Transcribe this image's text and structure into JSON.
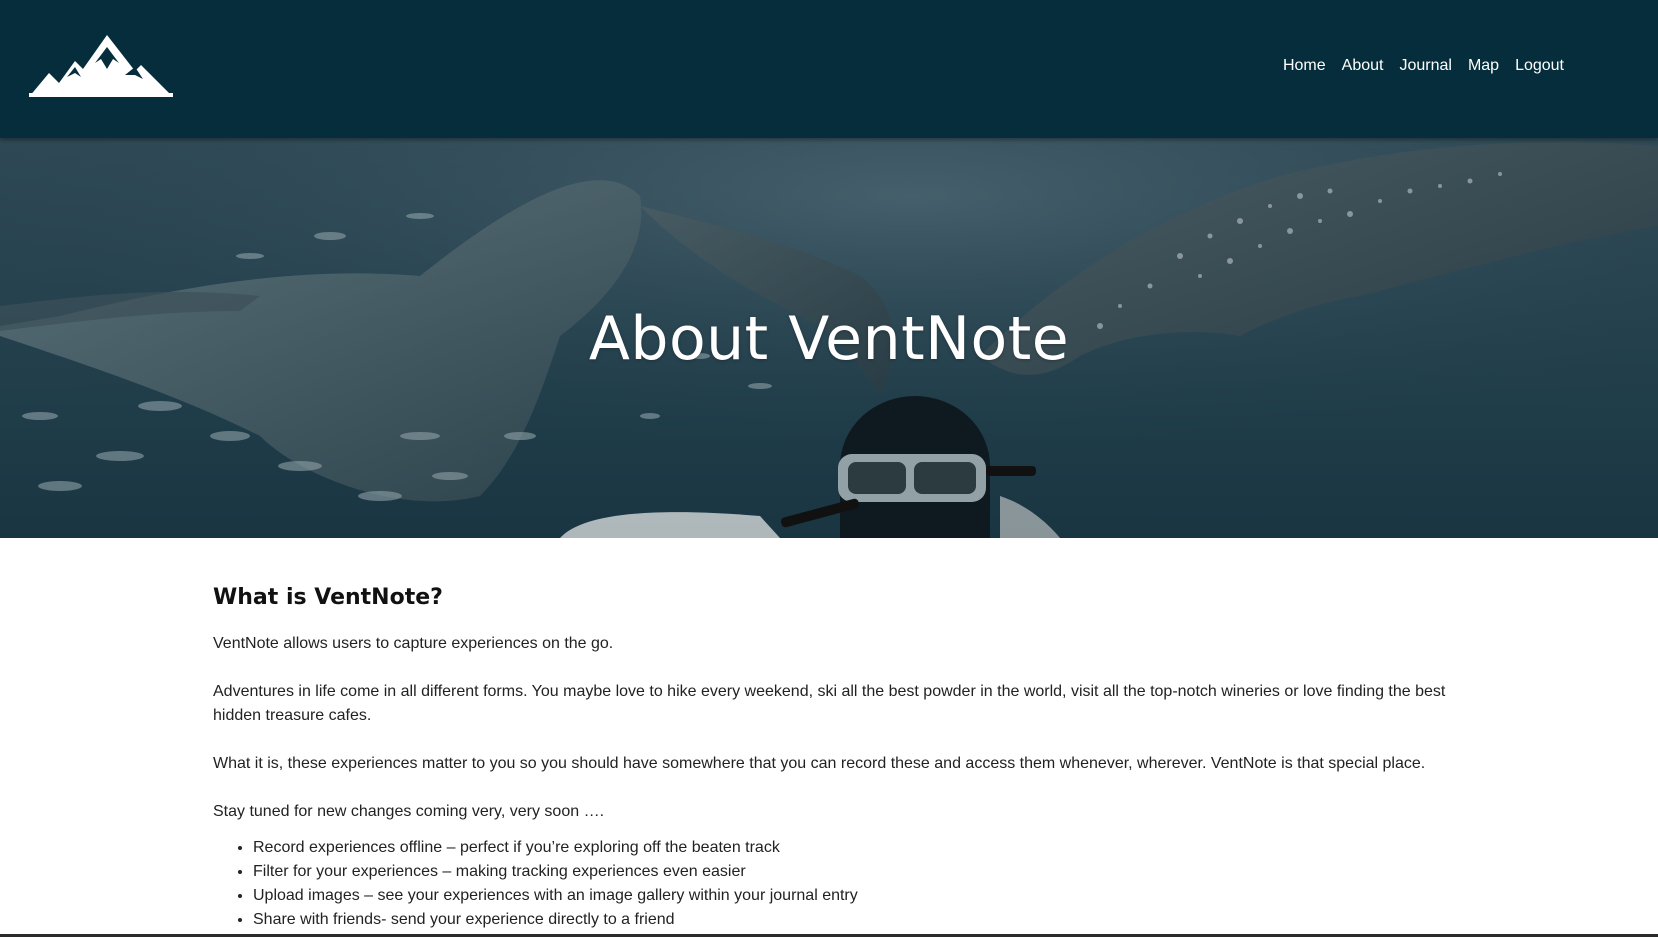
{
  "header": {
    "logo_icon": "mountain-logo-icon",
    "nav": [
      {
        "label": "Home"
      },
      {
        "label": "About"
      },
      {
        "label": "Journal"
      },
      {
        "label": "Map"
      },
      {
        "label": "Logout"
      }
    ],
    "background_color": "#062d3c"
  },
  "hero": {
    "title": "About VentNote",
    "image": "underwater-whale-sharks-snorkeler"
  },
  "main": {
    "heading": "What is VentNote?",
    "paragraphs": [
      "VentNote allows users to capture experiences on the go.",
      "Adventures in life come in all different forms. You maybe love to hike every weekend, ski all the best powder in the world, visit all the top-notch wineries or love finding the best hidden treasure cafes.",
      "What it is, these experiences matter to you so you should have somewhere that you can record these and access them whenever, wherever. VentNote is that special place.",
      "Stay tuned for new changes coming very, very soon …."
    ],
    "upcoming_features": [
      "Record experiences offline – perfect if you’re exploring off the beaten track",
      "Filter for your experiences – making tracking experiences even easier",
      "Upload images – see your experiences with an image gallery within your journal entry",
      "Share with friends- send your experience directly to a friend"
    ]
  }
}
